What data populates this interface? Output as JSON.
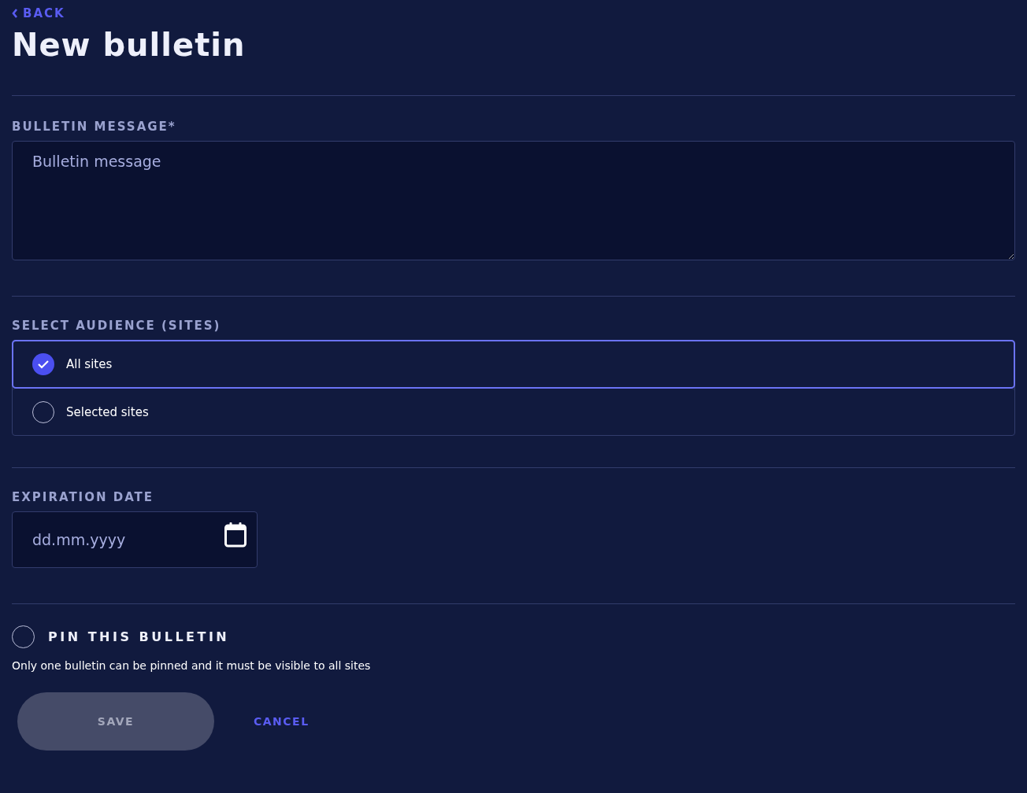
{
  "back_link": {
    "label": "BACK"
  },
  "title": "New bulletin",
  "message": {
    "label": "BULLETIN MESSAGE*",
    "placeholder": "Bulletin message"
  },
  "audience": {
    "label": "SELECT AUDIENCE (SITES)",
    "options": [
      {
        "label": "All sites",
        "selected": true
      },
      {
        "label": "Selected sites",
        "selected": false
      }
    ]
  },
  "expiration": {
    "label": "EXPIRATION DATE",
    "placeholder": "dd.mm.yyyy"
  },
  "pin": {
    "label": "PIN THIS BULLETIN",
    "checked": false,
    "note": "Only one bulletin can be pinned and it must be visible to all sites"
  },
  "buttons": [
    {
      "label": "SAVE",
      "kind": "primary",
      "disabled": true
    },
    {
      "label": "CANCEL",
      "kind": "link",
      "disabled": false
    }
  ]
}
